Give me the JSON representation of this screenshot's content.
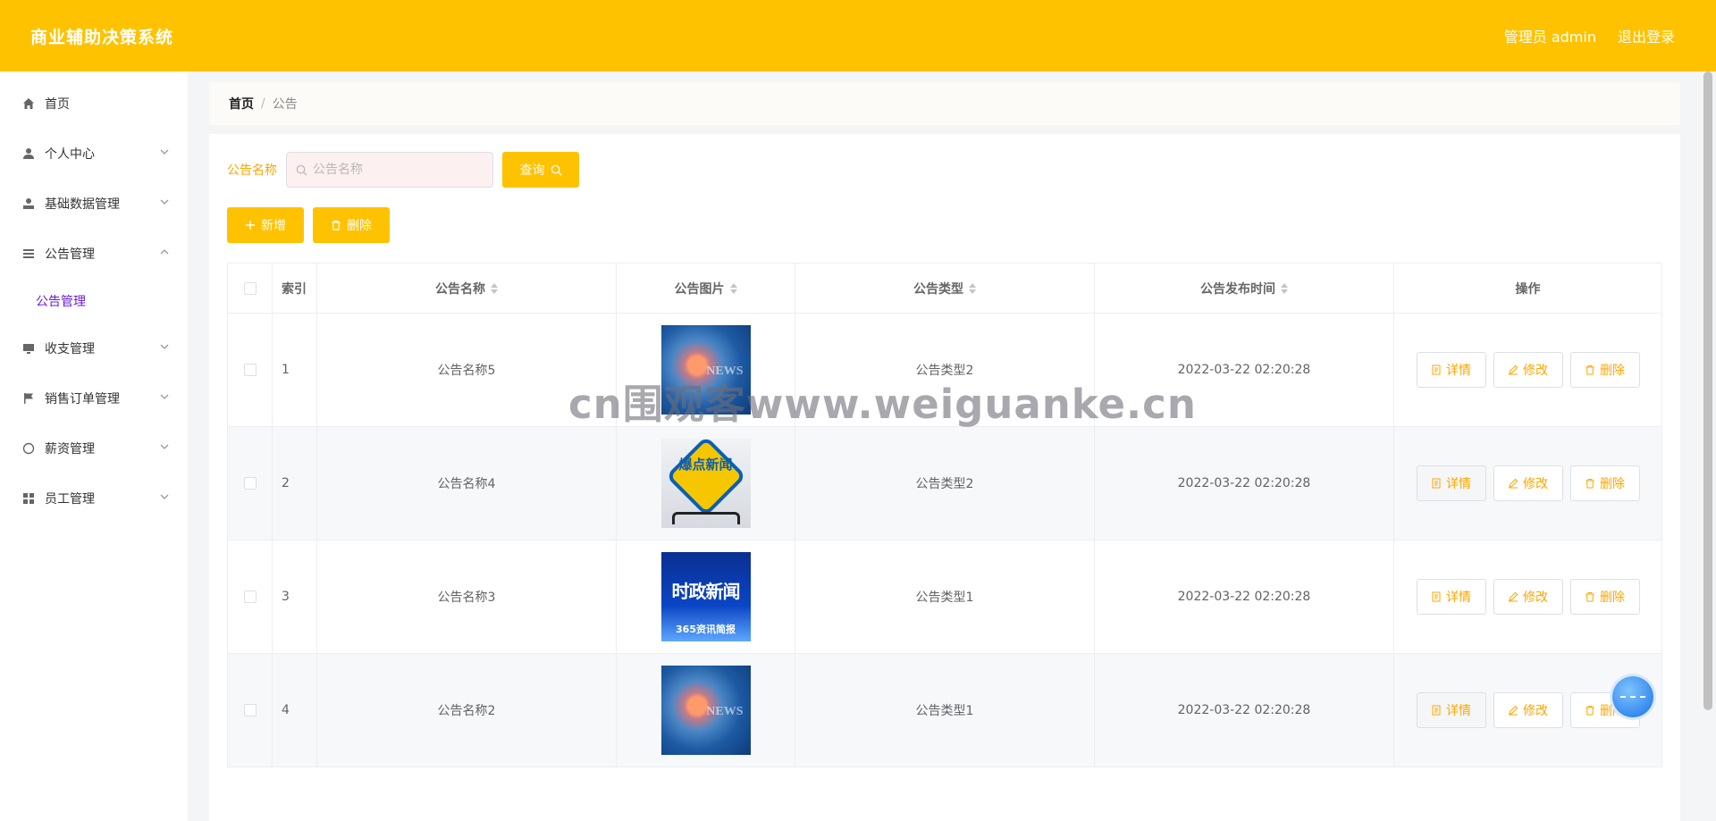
{
  "header": {
    "app_title": "商业辅助决策系统",
    "user_label": "管理员 admin",
    "logout_label": "退出登录"
  },
  "sidebar": {
    "items": [
      {
        "label": "首页",
        "icon": "home-icon"
      },
      {
        "label": "个人中心",
        "icon": "user-icon"
      },
      {
        "label": "基础数据管理",
        "icon": "stamp-icon"
      },
      {
        "label": "公告管理",
        "icon": "list-icon",
        "expanded": true
      },
      {
        "label": "收支管理",
        "icon": "monitor-icon"
      },
      {
        "label": "销售订单管理",
        "icon": "flag-icon"
      },
      {
        "label": "薪资管理",
        "icon": "compass-icon"
      },
      {
        "label": "员工管理",
        "icon": "grid-icon"
      }
    ],
    "sub_item_label": "公告管理"
  },
  "breadcrumb": {
    "home": "首页",
    "separator": "/",
    "current": "公告"
  },
  "search": {
    "label": "公告名称",
    "placeholder": "公告名称",
    "button_label": "查询"
  },
  "actions": {
    "add_label": "新增",
    "delete_label": "删除"
  },
  "table": {
    "headers": {
      "index": "索引",
      "name": "公告名称",
      "image": "公告图片",
      "type": "公告类型",
      "time": "公告发布时间",
      "ops": "操作"
    },
    "rows": [
      {
        "index": "1",
        "name": "公告名称5",
        "image": "news-thumbnail",
        "type": "公告类型2",
        "time": "2022-03-22 02:20:28"
      },
      {
        "index": "2",
        "name": "公告名称4",
        "image": "baodian-news-thumbnail",
        "type": "公告类型2",
        "time": "2022-03-22 02:20:28"
      },
      {
        "index": "3",
        "name": "公告名称3",
        "image": "shizheng-news-thumbnail",
        "type": "公告类型1",
        "time": "2022-03-22 02:20:28"
      },
      {
        "index": "4",
        "name": "公告名称2",
        "image": "news-thumbnail",
        "type": "公告类型1",
        "time": "2022-03-22 02:20:28"
      }
    ],
    "op_labels": {
      "detail": "详情",
      "edit": "修改",
      "delete": "删除"
    }
  },
  "images": {
    "baodian_text": "爆点新闻",
    "shizheng_big": "时政新闻",
    "shizheng_small": "365资讯简报",
    "news_word": "NEWS"
  },
  "watermark": "cn围观客www.weiguanke.cn",
  "colors": {
    "accent": "#ffc200",
    "accent_text": "#ffa500",
    "active_submenu": "#6a1bdc"
  }
}
